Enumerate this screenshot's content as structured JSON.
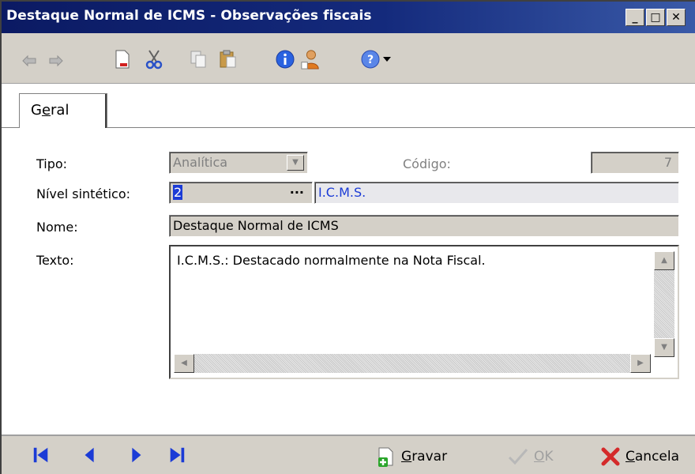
{
  "window": {
    "title": "Destaque Normal de ICMS -  Observações fiscais",
    "min_glyph": "_",
    "max_glyph": "□",
    "close_glyph": "✕"
  },
  "toolbar": {
    "icons": [
      "undo-icon",
      "redo-icon",
      "new-document-icon",
      "cut-icon",
      "copy-icon",
      "paste-icon",
      "info-icon",
      "user-icon",
      "help-icon",
      "dropdown-arrow-icon"
    ]
  },
  "tabs": [
    {
      "label_pre": "G",
      "label_acc": "e",
      "label_post": "ral"
    }
  ],
  "form": {
    "tipo_label": "Tipo:",
    "tipo_value": "Analítica",
    "codigo_label": "Código:",
    "codigo_value": "7",
    "nivel_label": "Nível sintético:",
    "nivel_value": "2",
    "nivel_ellipsis": "···",
    "nivel_desc": "I.C.M.S.",
    "nome_label": "Nome:",
    "nome_value": "Destaque Normal de ICMS",
    "texto_label": "Texto:",
    "texto_value": "I.C.M.S.: Destacado normalmente na Nota Fiscal."
  },
  "footer": {
    "gravar_acc": "G",
    "gravar_rest": "ravar",
    "ok_acc": "O",
    "ok_rest": "K",
    "cancela_acc": "C",
    "cancela_rest": "ancela"
  },
  "colors": {
    "title_bar": "#0b1a63",
    "accent_blue": "#1b3bd6",
    "cancel_red": "#d42a2a",
    "gravar_green": "#2aa52a"
  }
}
